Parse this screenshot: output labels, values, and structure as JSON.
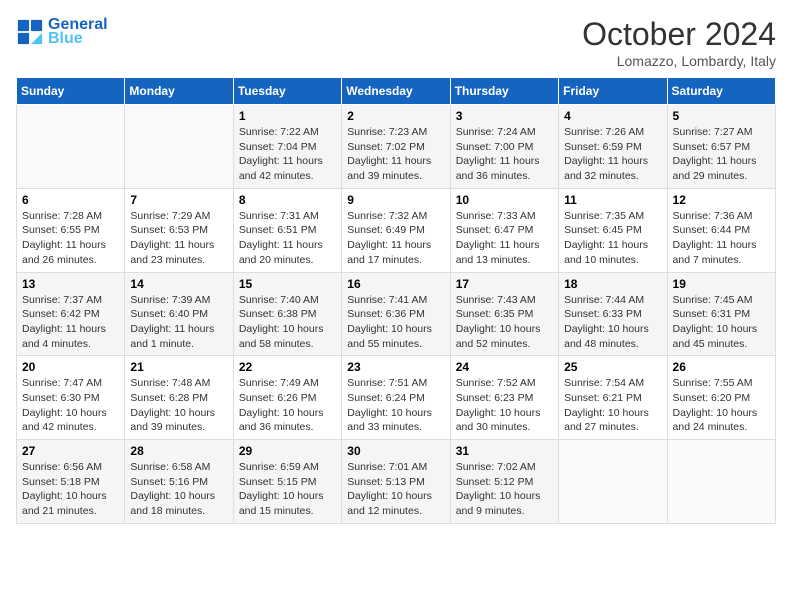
{
  "header": {
    "logo_line1": "General",
    "logo_line2": "Blue",
    "month": "October 2024",
    "location": "Lomazzo, Lombardy, Italy"
  },
  "days_of_week": [
    "Sunday",
    "Monday",
    "Tuesday",
    "Wednesday",
    "Thursday",
    "Friday",
    "Saturday"
  ],
  "weeks": [
    [
      {
        "num": "",
        "detail": ""
      },
      {
        "num": "",
        "detail": ""
      },
      {
        "num": "1",
        "detail": "Sunrise: 7:22 AM\nSunset: 7:04 PM\nDaylight: 11 hours and 42 minutes."
      },
      {
        "num": "2",
        "detail": "Sunrise: 7:23 AM\nSunset: 7:02 PM\nDaylight: 11 hours and 39 minutes."
      },
      {
        "num": "3",
        "detail": "Sunrise: 7:24 AM\nSunset: 7:00 PM\nDaylight: 11 hours and 36 minutes."
      },
      {
        "num": "4",
        "detail": "Sunrise: 7:26 AM\nSunset: 6:59 PM\nDaylight: 11 hours and 32 minutes."
      },
      {
        "num": "5",
        "detail": "Sunrise: 7:27 AM\nSunset: 6:57 PM\nDaylight: 11 hours and 29 minutes."
      }
    ],
    [
      {
        "num": "6",
        "detail": "Sunrise: 7:28 AM\nSunset: 6:55 PM\nDaylight: 11 hours and 26 minutes."
      },
      {
        "num": "7",
        "detail": "Sunrise: 7:29 AM\nSunset: 6:53 PM\nDaylight: 11 hours and 23 minutes."
      },
      {
        "num": "8",
        "detail": "Sunrise: 7:31 AM\nSunset: 6:51 PM\nDaylight: 11 hours and 20 minutes."
      },
      {
        "num": "9",
        "detail": "Sunrise: 7:32 AM\nSunset: 6:49 PM\nDaylight: 11 hours and 17 minutes."
      },
      {
        "num": "10",
        "detail": "Sunrise: 7:33 AM\nSunset: 6:47 PM\nDaylight: 11 hours and 13 minutes."
      },
      {
        "num": "11",
        "detail": "Sunrise: 7:35 AM\nSunset: 6:45 PM\nDaylight: 11 hours and 10 minutes."
      },
      {
        "num": "12",
        "detail": "Sunrise: 7:36 AM\nSunset: 6:44 PM\nDaylight: 11 hours and 7 minutes."
      }
    ],
    [
      {
        "num": "13",
        "detail": "Sunrise: 7:37 AM\nSunset: 6:42 PM\nDaylight: 11 hours and 4 minutes."
      },
      {
        "num": "14",
        "detail": "Sunrise: 7:39 AM\nSunset: 6:40 PM\nDaylight: 11 hours and 1 minute."
      },
      {
        "num": "15",
        "detail": "Sunrise: 7:40 AM\nSunset: 6:38 PM\nDaylight: 10 hours and 58 minutes."
      },
      {
        "num": "16",
        "detail": "Sunrise: 7:41 AM\nSunset: 6:36 PM\nDaylight: 10 hours and 55 minutes."
      },
      {
        "num": "17",
        "detail": "Sunrise: 7:43 AM\nSunset: 6:35 PM\nDaylight: 10 hours and 52 minutes."
      },
      {
        "num": "18",
        "detail": "Sunrise: 7:44 AM\nSunset: 6:33 PM\nDaylight: 10 hours and 48 minutes."
      },
      {
        "num": "19",
        "detail": "Sunrise: 7:45 AM\nSunset: 6:31 PM\nDaylight: 10 hours and 45 minutes."
      }
    ],
    [
      {
        "num": "20",
        "detail": "Sunrise: 7:47 AM\nSunset: 6:30 PM\nDaylight: 10 hours and 42 minutes."
      },
      {
        "num": "21",
        "detail": "Sunrise: 7:48 AM\nSunset: 6:28 PM\nDaylight: 10 hours and 39 minutes."
      },
      {
        "num": "22",
        "detail": "Sunrise: 7:49 AM\nSunset: 6:26 PM\nDaylight: 10 hours and 36 minutes."
      },
      {
        "num": "23",
        "detail": "Sunrise: 7:51 AM\nSunset: 6:24 PM\nDaylight: 10 hours and 33 minutes."
      },
      {
        "num": "24",
        "detail": "Sunrise: 7:52 AM\nSunset: 6:23 PM\nDaylight: 10 hours and 30 minutes."
      },
      {
        "num": "25",
        "detail": "Sunrise: 7:54 AM\nSunset: 6:21 PM\nDaylight: 10 hours and 27 minutes."
      },
      {
        "num": "26",
        "detail": "Sunrise: 7:55 AM\nSunset: 6:20 PM\nDaylight: 10 hours and 24 minutes."
      }
    ],
    [
      {
        "num": "27",
        "detail": "Sunrise: 6:56 AM\nSunset: 5:18 PM\nDaylight: 10 hours and 21 minutes."
      },
      {
        "num": "28",
        "detail": "Sunrise: 6:58 AM\nSunset: 5:16 PM\nDaylight: 10 hours and 18 minutes."
      },
      {
        "num": "29",
        "detail": "Sunrise: 6:59 AM\nSunset: 5:15 PM\nDaylight: 10 hours and 15 minutes."
      },
      {
        "num": "30",
        "detail": "Sunrise: 7:01 AM\nSunset: 5:13 PM\nDaylight: 10 hours and 12 minutes."
      },
      {
        "num": "31",
        "detail": "Sunrise: 7:02 AM\nSunset: 5:12 PM\nDaylight: 10 hours and 9 minutes."
      },
      {
        "num": "",
        "detail": ""
      },
      {
        "num": "",
        "detail": ""
      }
    ]
  ]
}
